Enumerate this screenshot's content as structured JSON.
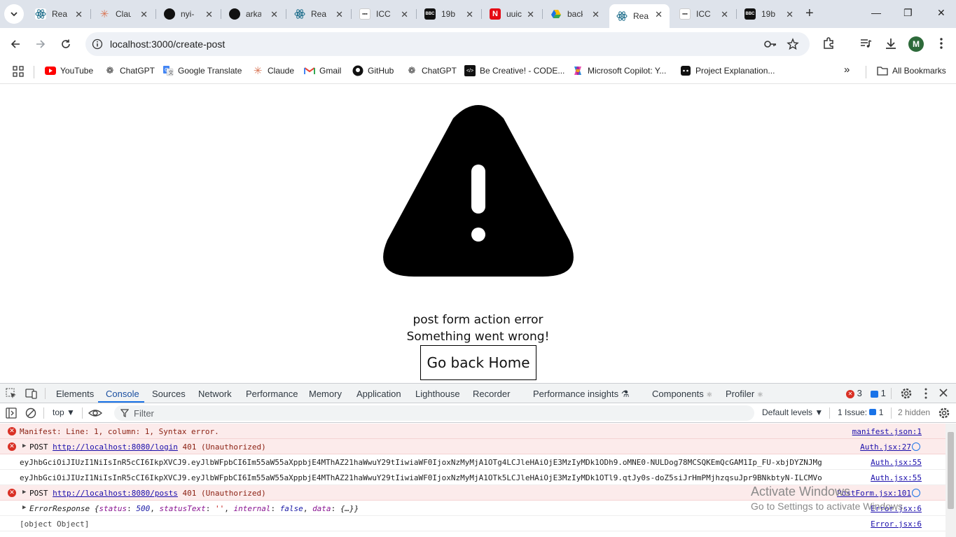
{
  "browser": {
    "tabs": [
      {
        "label": "React",
        "icon": "react-icon",
        "close": "✕"
      },
      {
        "label": "Claude",
        "icon": "claude-icon",
        "close": "✕"
      },
      {
        "label": "nyi-",
        "icon": "github-icon",
        "close": "✕"
      },
      {
        "label": "arka",
        "icon": "github-icon",
        "close": "✕"
      },
      {
        "label": "React",
        "icon": "react-icon",
        "close": "✕"
      },
      {
        "label": "ICC",
        "icon": "icc-icon",
        "close": "✕"
      },
      {
        "label": "19b",
        "icon": "bbc-icon",
        "close": "✕"
      },
      {
        "label": "uuic",
        "icon": "netflix-icon",
        "close": "✕"
      },
      {
        "label": "back",
        "icon": "drive-icon",
        "close": "✕"
      },
      {
        "label": "React",
        "icon": "react-icon",
        "close": "✕",
        "active": true
      },
      {
        "label": "ICC",
        "icon": "icc-icon",
        "close": "✕"
      },
      {
        "label": "19b",
        "icon": "bbc-icon",
        "close": "✕"
      }
    ],
    "new_tab": "+",
    "window": {
      "minimize": "—",
      "restore": "❐",
      "close": "✕"
    },
    "url": "localhost:3000/create-post",
    "profile_initial": "M",
    "bookmarks": [
      {
        "label": "YouTube",
        "icon": "youtube-icon"
      },
      {
        "label": "ChatGPT",
        "icon": "chatgpt-icon"
      },
      {
        "label": "Google Translate",
        "icon": "translate-icon"
      },
      {
        "label": "Claude",
        "icon": "claude-icon"
      },
      {
        "label": "Gmail",
        "icon": "gmail-icon"
      },
      {
        "label": "GitHub",
        "icon": "github-icon"
      },
      {
        "label": "ChatGPT",
        "icon": "chatgpt-icon"
      },
      {
        "label": "Be Creative! - CODE...",
        "icon": "code-icon"
      },
      {
        "label": "Microsoft Copilot: Y...",
        "icon": "copilot-icon"
      },
      {
        "label": "Project Explanation...",
        "icon": "chat-icon"
      }
    ],
    "more_bookmarks": "»",
    "all_bookmarks": "All Bookmarks"
  },
  "page": {
    "error_title": "post form action error",
    "error_subtitle": "Something went wrong!",
    "home_button": "Go back Home"
  },
  "devtools": {
    "tabs": [
      "Elements",
      "Console",
      "Sources",
      "Network",
      "Performance",
      "Memory",
      "Application",
      "Lighthouse",
      "Recorder",
      "Performance insights",
      "Components",
      "Profiler"
    ],
    "active_tab": "Console",
    "error_count": "3",
    "issue_count": "1",
    "context": "top",
    "filter_placeholder": "Filter",
    "levels": "Default levels",
    "issues_label": "1 Issue:",
    "issues_num": "1",
    "hidden": "2 hidden",
    "logs": [
      {
        "type": "error",
        "text": "Manifest: Line: 1, column: 1, Syntax error.",
        "source": "manifest.json:1"
      },
      {
        "type": "error",
        "prefix": "POST ",
        "link": "http://localhost:8080/login",
        "suffix": " 401 (Unauthorized)",
        "source": "Auth.jsx:27"
      },
      {
        "type": "log",
        "text": "eyJhbGciOiJIUzI1NiIsInR5cCI6IkpXVCJ9.eyJlbWFpbCI6Im55aW55aXppbjE4MThAZ21haWwuY29tIiwiaWF0IjoxNzMyMjA1OTg4LCJleHAiOjE3MzIyMDk1ODh9.oMNE0-NULDog78MCSQKEmQcGAM1Ip_FU-xbjDYZNJMg",
        "source": "Auth.jsx:55"
      },
      {
        "type": "log",
        "text": "eyJhbGciOiJIUzI1NiIsInR5cCI6IkpXVCJ9.eyJlbWFpbCI6Im55aW55aXppbjE4MThAZ21haWwuY29tIiwiaWF0IjoxNzMyMjA1OTk5LCJleHAiOjE3MzIyMDk1OTl9.qtJy0s-doZ5siJrHmPMjhzqsuJpr9BNkbtyN-ILCMVo",
        "source": "Auth.jsx:55"
      },
      {
        "type": "error",
        "prefix": "POST ",
        "link": "http://localhost:8080/posts",
        "suffix": " 401 (Unauthorized)",
        "source": "PostForm.jsx:101"
      },
      {
        "type": "object",
        "name": "ErrorResponse",
        "source": "Error.jsx:6"
      },
      {
        "type": "log",
        "text": "[object Object]",
        "source": "Error.jsx:6"
      }
    ],
    "error_response": {
      "status_key": "status",
      "status_val": "500",
      "statusText_key": "statusText",
      "statusText_val": "''",
      "internal_key": "internal",
      "internal_val": "false",
      "data_key": "data",
      "data_val": "{…}"
    }
  },
  "watermark": {
    "title": "Activate Windows",
    "subtitle": "Go to Settings to activate Windows."
  }
}
